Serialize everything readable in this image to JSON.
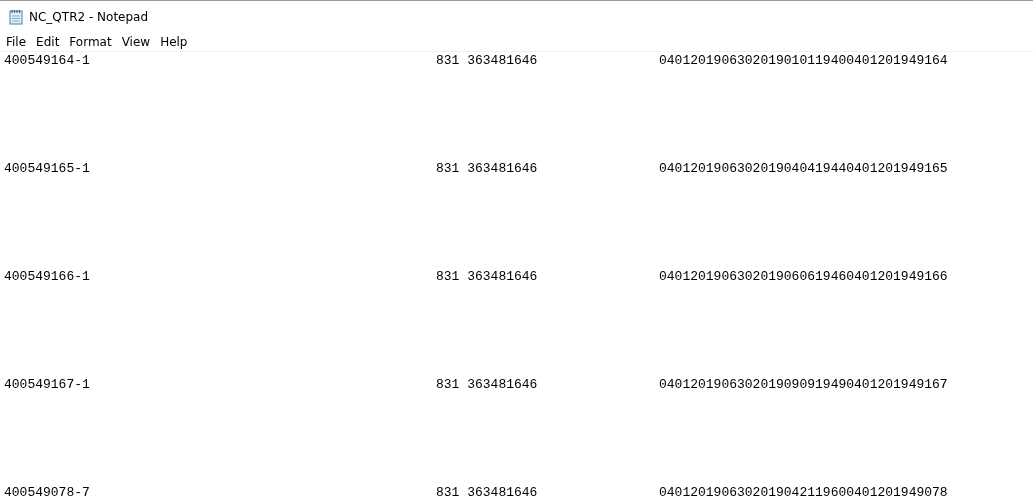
{
  "window": {
    "title": "NC_QTR2 - Notepad"
  },
  "menu": [
    "File",
    "Edit",
    "Format",
    "View",
    "Help"
  ],
  "rows": [
    {
      "column_1": "400549164-1",
      "column_2": "831 363481646",
      "column_3": "0401201906302019010119400401201949164"
    },
    {
      "column_1": "400549165-1",
      "column_2": "831 363481646",
      "column_3": "0401201906302019040419440401201949165"
    },
    {
      "column_1": "400549166-1",
      "column_2": "831 363481646",
      "column_3": "0401201906302019060619460401201949166"
    },
    {
      "column_1": "400549167-1",
      "column_2": "831 363481646",
      "column_3": "0401201906302019090919490401201949167"
    },
    {
      "column_1": "400549078-7",
      "column_2": "831 363481646",
      "column_3": "0401201906302019042119600401201949078"
    }
  ]
}
